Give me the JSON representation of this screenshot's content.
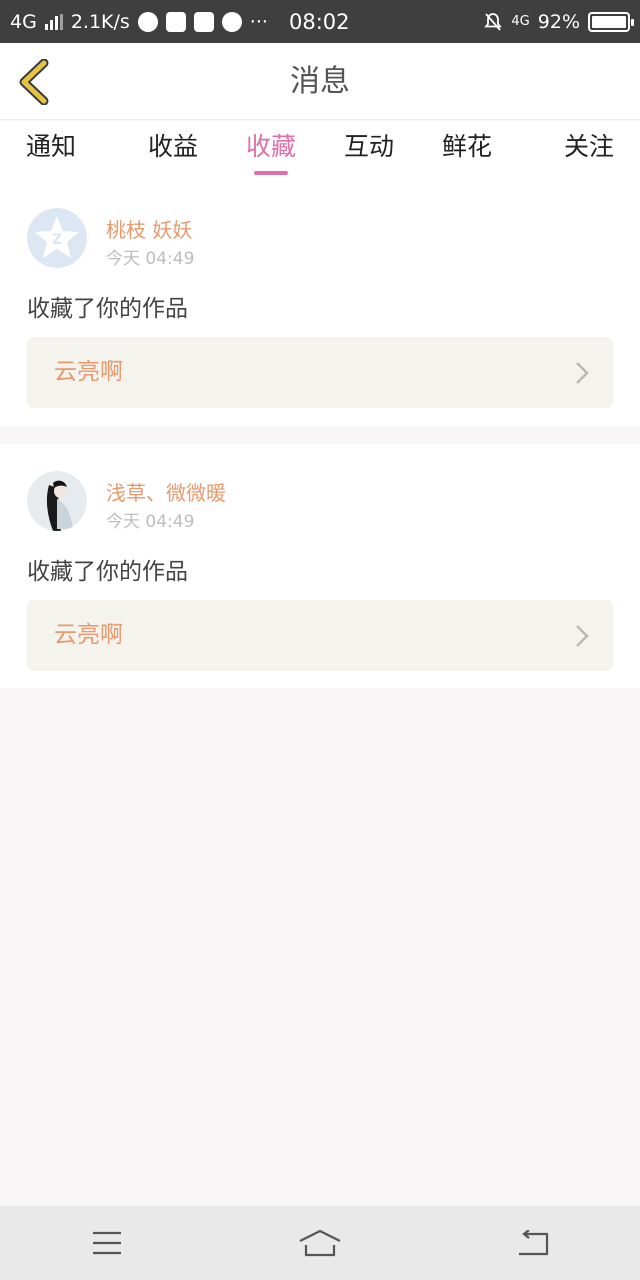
{
  "status_bar": {
    "network": "4G",
    "speed": "2.1K/s",
    "time": "08:02",
    "network_right": "4G",
    "battery": "92%",
    "more": "···"
  },
  "header": {
    "title": "消息"
  },
  "tabs": [
    {
      "label": "通知",
      "active": false
    },
    {
      "label": "收益",
      "active": false
    },
    {
      "label": "收藏",
      "active": true
    },
    {
      "label": "互动",
      "active": false
    },
    {
      "label": "鲜花",
      "active": false
    },
    {
      "label": "关注",
      "active": false
    }
  ],
  "messages": [
    {
      "user": "桃枝 妖妖",
      "time": "今天 04:49",
      "action": "收藏了你的作品",
      "work_title": "云亮啊",
      "avatar": "default-star-avatar"
    },
    {
      "user": "浅草、微微暖",
      "time": "今天 04:49",
      "action": "收藏了你的作品",
      "work_title": "云亮啊",
      "avatar": "illustrated-girl-avatar"
    }
  ],
  "colors": {
    "accent_pink": "#e070a8",
    "name_orange": "#e89a6e",
    "back_yellow": "#e6c340"
  }
}
